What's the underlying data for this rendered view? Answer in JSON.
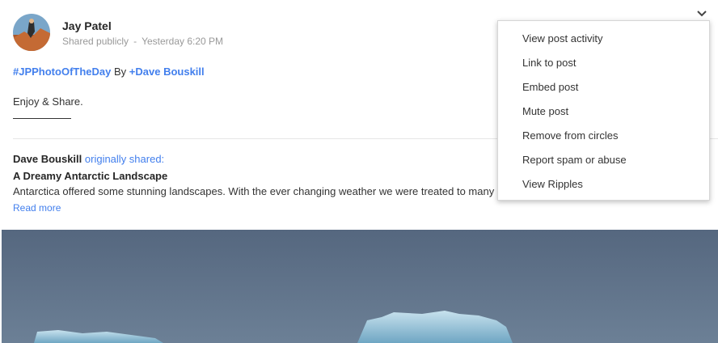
{
  "post": {
    "author": "Jay Patel",
    "visibility": "Shared publicly",
    "separator": "-",
    "timestamp": "Yesterday 6:20 PM",
    "hashtag": "#JPPhotoOfTheDay",
    "by_text": "By",
    "mention": "+Dave Bouskill",
    "body": "Enjoy & Share."
  },
  "shared": {
    "sharer_name": "Dave Bouskill",
    "originally_shared": "originally shared:",
    "title": "A Dreamy Antarctic Landscape",
    "description": "Antarctica offered some stunning landscapes. With the ever changing weather we were treated to many d",
    "read_more": "Read more"
  },
  "menu": {
    "items": [
      "View post activity",
      "Link to post",
      "Embed post",
      "Mute post",
      "Remove from circles",
      "Report spam or abuse",
      "View Ripples"
    ]
  },
  "icons": {
    "menu_toggle": "chevron-down-icon"
  },
  "colors": {
    "link": "#427fed",
    "photo_sky": "#4d6280",
    "ice": "#8fc0d8"
  }
}
